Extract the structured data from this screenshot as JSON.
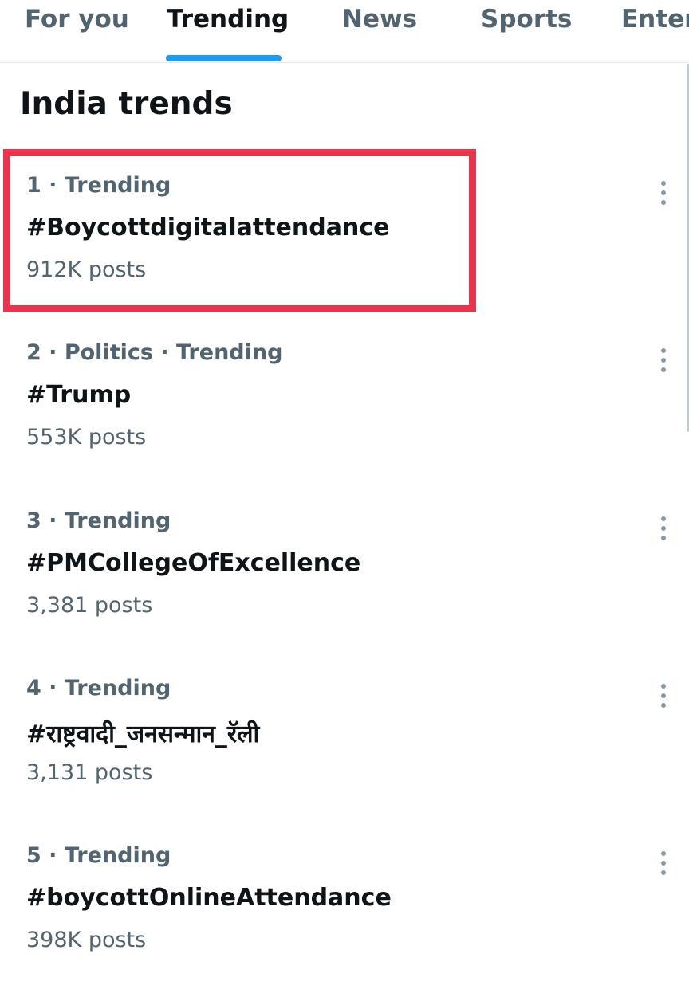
{
  "tabs": [
    {
      "label": "For you",
      "active": false
    },
    {
      "label": "Trending",
      "active": true
    },
    {
      "label": "News",
      "active": false
    },
    {
      "label": "Sports",
      "active": false
    },
    {
      "label": "Enter",
      "active": false
    }
  ],
  "section": {
    "title": "India trends"
  },
  "trends": [
    {
      "meta": "1 · Trending",
      "name": "#Boycottdigitalattendance",
      "count": "912K posts",
      "highlighted": true
    },
    {
      "meta": "2 · Politics · Trending",
      "name": "#Trump",
      "count": "553K posts"
    },
    {
      "meta": "3 · Trending",
      "name": "#PMCollegeOfExcellence",
      "count": "3,381 posts"
    },
    {
      "meta": "4 · Trending",
      "name": "#राष्ट्रवादी_जनसन्मान_रॅली",
      "count": "3,131 posts"
    },
    {
      "meta": "5 · Trending",
      "name": "#boycottOnlineAttendance",
      "count": "398K posts"
    }
  ],
  "icons": {
    "more": "more-vertical-icon"
  },
  "colors": {
    "accent": "#1d9bf0",
    "highlight": "#e8344e",
    "secondary_text": "#536471",
    "primary_text": "#0f1419"
  }
}
